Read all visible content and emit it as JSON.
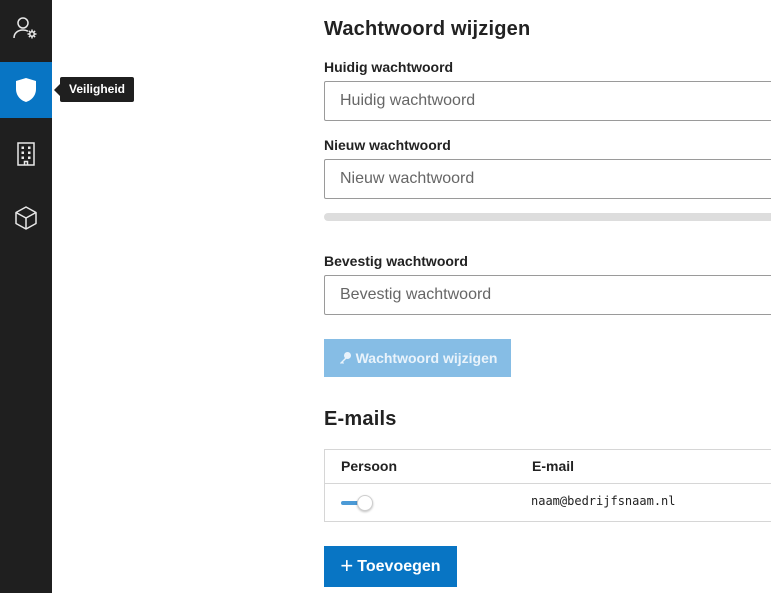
{
  "sidebar": {
    "items": [
      {
        "icon": "user-settings-icon"
      },
      {
        "icon": "shield-icon",
        "active": true
      },
      {
        "icon": "building-icon"
      },
      {
        "icon": "cube-icon"
      }
    ],
    "tooltip": "Veiligheid"
  },
  "password_section": {
    "title": "Wachtwoord wijzigen",
    "current_label": "Huidig wachtwoord",
    "current_placeholder": "Huidig wachtwoord",
    "new_label": "Nieuw wachtwoord",
    "new_placeholder": "Nieuw wachtwoord",
    "strength": 0,
    "confirm_label": "Bevestig wachtwoord",
    "confirm_placeholder": "Bevestig wachtwoord",
    "submit_label": "Wachtwoord wijzigen",
    "submit_icon": "key-icon"
  },
  "emails_section": {
    "title": "E-mails",
    "columns": [
      "Persoon",
      "E-mail"
    ],
    "rows": [
      {
        "persoon_toggle": true,
        "email": "naam@bedrijfsnaam.nl"
      }
    ],
    "add_label": "Toevoegen",
    "add_icon": "plus-icon"
  },
  "colors": {
    "accent": "#0875c4",
    "accent_disabled": "#86bde5",
    "sidebar_bg": "#1f1f1f"
  }
}
